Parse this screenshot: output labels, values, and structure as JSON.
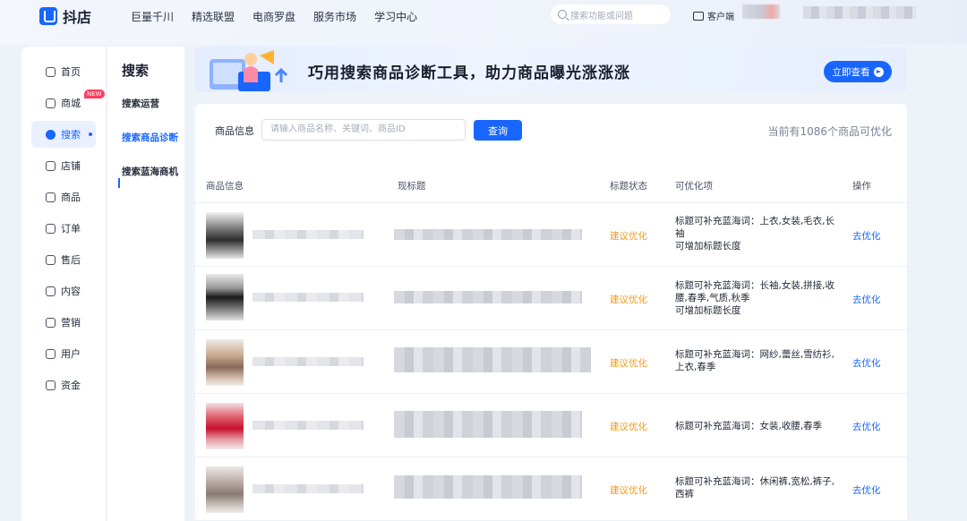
{
  "brand": {
    "name": "抖店"
  },
  "top_nav": [
    "巨量千川",
    "精选联盟",
    "电商罗盘",
    "服务市场",
    "学习中心"
  ],
  "top_search": {
    "placeholder": "搜索功能或问题"
  },
  "client_label": "客户端",
  "side_nav": [
    {
      "label": "首页",
      "icon": "home-icon"
    },
    {
      "label": "商城",
      "icon": "mall-icon",
      "badge": "NEW"
    },
    {
      "label": "搜索",
      "icon": "search-icon",
      "active": true
    },
    {
      "label": "店铺",
      "icon": "shop-icon"
    },
    {
      "label": "商品",
      "icon": "product-icon"
    },
    {
      "label": "订单",
      "icon": "order-icon"
    },
    {
      "label": "售后",
      "icon": "after-sale-icon"
    },
    {
      "label": "内容",
      "icon": "content-icon"
    },
    {
      "label": "营销",
      "icon": "megaphone-icon"
    },
    {
      "label": "用户",
      "icon": "user-icon"
    },
    {
      "label": "资金",
      "icon": "wallet-icon"
    }
  ],
  "sub_nav": {
    "title": "搜索",
    "items": [
      "搜索运营",
      "搜索商品诊断",
      "搜索蓝海商机"
    ],
    "active_index": 1
  },
  "banner": {
    "title": "巧用搜索商品诊断工具，助力商品曝光涨涨涨",
    "button": "立即查看"
  },
  "filter": {
    "label": "商品信息",
    "placeholder": "请输入商品名称、关键词、商品ID",
    "query_button": "查询",
    "count_text": "当前有1086个商品可优化"
  },
  "table": {
    "headers": [
      "商品信息",
      "现标题",
      "标题状态",
      "可优化项",
      "操作"
    ],
    "rows": [
      {
        "status": "建议优化",
        "optimizable": [
          "标题可补充蓝海词：上衣,女装,毛衣,长袖",
          "可增加标题长度"
        ],
        "action": "去优化"
      },
      {
        "status": "建议优化",
        "optimizable": [
          "标题可补充蓝海词：长袖,女装,拼接,收腰,春季,气质,秋季",
          "可增加标题长度"
        ],
        "action": "去优化"
      },
      {
        "status": "建议优化",
        "optimizable": [
          "标题可补充蓝海词：网纱,蕾丝,雪纺衫,上衣,春季"
        ],
        "action": "去优化"
      },
      {
        "status": "建议优化",
        "optimizable": [
          "标题可补充蓝海词：女装,收腰,春季"
        ],
        "action": "去优化"
      },
      {
        "status": "建议优化",
        "optimizable": [
          "标题可补充蓝海词：休闲裤,宽松,裤子,西裤"
        ],
        "action": "去优化"
      }
    ]
  },
  "colors": {
    "accent": "#1966ff",
    "warning": "#f29a1b",
    "badge": "#ff3d5c"
  }
}
